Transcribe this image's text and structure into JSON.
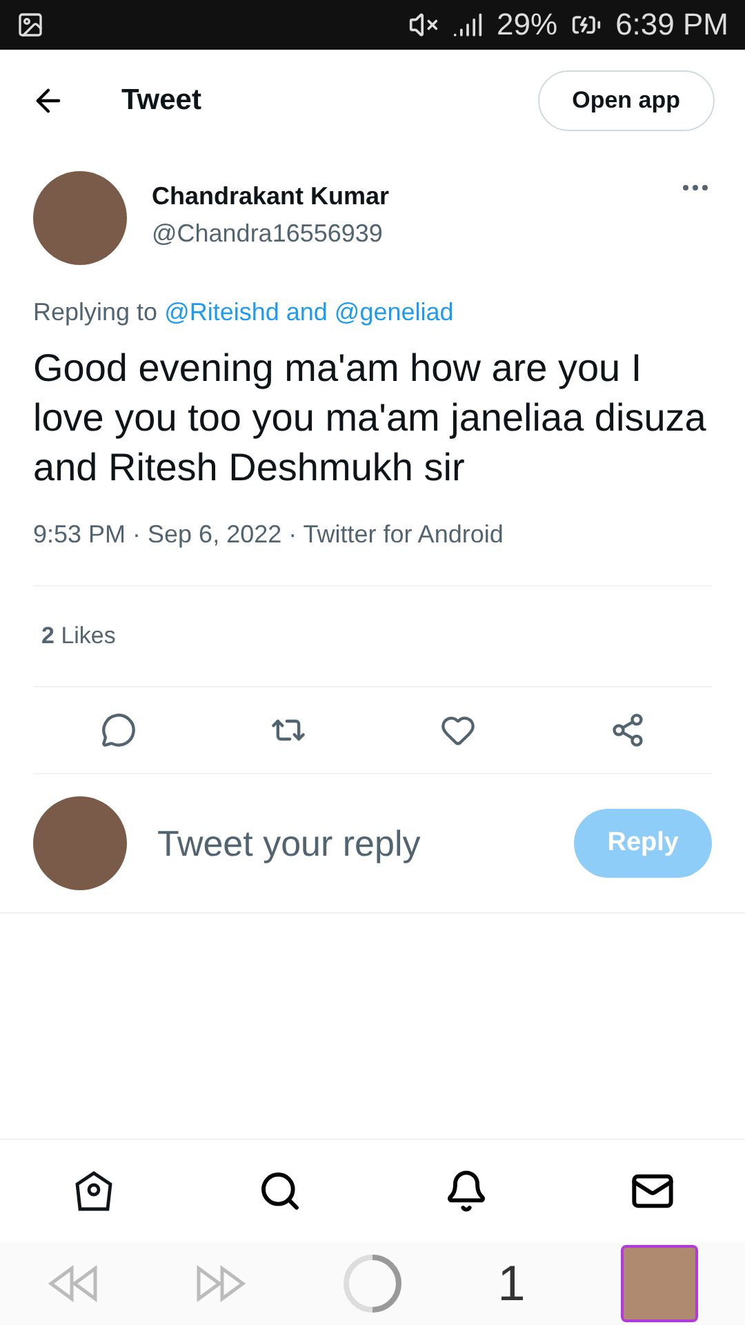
{
  "status_bar": {
    "battery": "29%",
    "time": "6:39 PM"
  },
  "header": {
    "title": "Tweet",
    "open_app": "Open app"
  },
  "tweet": {
    "name": "Chandrakant Kumar",
    "handle": "@Chandra16556939",
    "replying_prefix": "Replying to",
    "replying_to": "@Riteishd and @geneliad",
    "text": "Good evening ma'am how are you I love you too you ma'am janeliaa disuza and Ritesh Deshmukh sir",
    "meta": "9:53 PM · Sep 6, 2022 · Twitter for Android",
    "likes_count": "2",
    "likes_label": "Likes"
  },
  "reply": {
    "placeholder": "Tweet your reply",
    "button": "Reply",
    "disabled": true
  },
  "nav": [
    {
      "kind": "home"
    },
    {
      "kind": "search"
    },
    {
      "kind": "bell"
    },
    {
      "kind": "mail"
    }
  ],
  "browser": {
    "tab_count": "1"
  }
}
